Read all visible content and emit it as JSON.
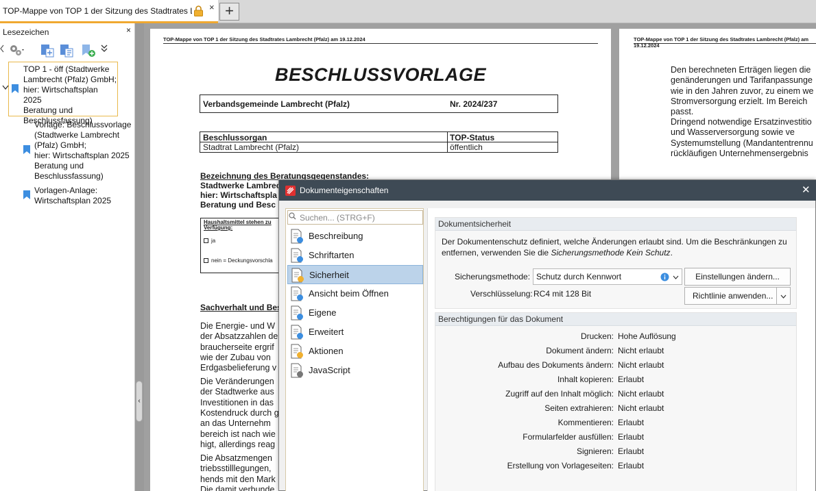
{
  "tab": {
    "title": "TOP-Mappe von TOP 1 der Sitzung des Stadtrates L...",
    "close": "×",
    "new_tab": "+"
  },
  "bookmarks": {
    "title": "Lesezeichen",
    "close": "×",
    "items": [
      {
        "label": "TOP 1 - öff (Stadtwerke\nLambrecht (Pfalz) GmbH;\nhier: Wirtschaftsplan 2025\nBeratung und\nBeschlussfassung)"
      },
      {
        "label": "Vorlage: Beschlussvorlage\n(Stadtwerke Lambrecht\n(Pfalz) GmbH;\nhier: Wirtschaftsplan 2025\nBeratung und\nBeschlussfassung)"
      },
      {
        "label": "Vorlagen-Anlage:\nWirtschaftsplan 2025"
      }
    ]
  },
  "page1": {
    "header": "TOP-Mappe von TOP 1 der Sitzung des Stadtrates Lambrecht (Pfalz) am 19.12.2024",
    "title": "BESCHLUSSVORLAGE",
    "org": "Verbandsgemeinde Lambrecht (Pfalz)",
    "nr": "Nr. 2024/237",
    "col1_head": "Beschlussorgan",
    "col2_head": "TOP-Status",
    "col1_val": "Stadtrat Lambrecht (Pfalz)",
    "col2_val": "öffentlich",
    "bez_lines": [
      "Bezeichnung des Beratungsgegenstandes:",
      "Stadtwerke Lambrec",
      "hier: Wirtschaftspla",
      "Beratung und Besc"
    ],
    "haushalt_1": "Haushaltsmittel stehen zu",
    "haushalt_2": "Verfügung:",
    "ja": "ja",
    "nein": "nein = Deckungsvorschla",
    "sachverhalt": "Sachverhalt und Bes",
    "para1": [
      "Die Energie- und W",
      "der Absatzzahlen de",
      "braucherseite ergrif",
      "wie der Zubau von",
      "Erdgasbelieferung v"
    ],
    "para2": [
      "Die Veränderungen",
      "der Stadtwerke aus",
      "Investitionen in das",
      "Kostendruck durch g",
      "an das Unternehm",
      "bereich ist nach wie",
      "higt, allerdings reag"
    ],
    "para3": [
      "Die Absatzmengen",
      "triebsstilllegungen,",
      "hends mit den Mark",
      "Die damit verbunde"
    ]
  },
  "page2": {
    "header": "TOP-Mappe von TOP 1 der Sitzung des Stadtrates Lambrecht (Pfalz) am 19.12.2024",
    "para1": [
      "Den berechneten Erträgen liegen die",
      "genänderungen und Tarifanpassunge",
      "wie in den Jahren zuvor, zu einem we",
      "Stromversorgung erzielt. Im Bereich",
      "passt."
    ],
    "para2": [
      "Dringend notwendige Ersatzinvestitio",
      "und    Wasserversorgung    sowie   ve",
      "Systemumstellung (Mandantentrennu",
      "rückläufigen Unternehmensergebnis"
    ]
  },
  "dialog": {
    "title": "Dokumenteigenschaften",
    "close": "✕",
    "search_placeholder": "Suchen... (STRG+F)",
    "nav": [
      {
        "label": "Beschreibung",
        "icon": "description-icon"
      },
      {
        "label": "Schriftarten",
        "icon": "fonts-icon"
      },
      {
        "label": "Sicherheit",
        "icon": "security-icon"
      },
      {
        "label": "Ansicht beim Öffnen",
        "icon": "view-on-open-icon"
      },
      {
        "label": "Eigene",
        "icon": "custom-properties-icon"
      },
      {
        "label": "Erweitert",
        "icon": "advanced-icon"
      },
      {
        "label": "Aktionen",
        "icon": "actions-icon"
      },
      {
        "label": "JavaScript",
        "icon": "javascript-icon"
      }
    ],
    "security": {
      "heading": "Dokumentsicherheit",
      "desc1": "Der Dokumentenschutz definiert, welche Änderungen erlaubt sind. Um die Beschränkungen zu",
      "desc2a": "entfernen, verwenden Sie die ",
      "desc2b": "Sicherungsmethode Kein Schutz",
      "desc2c": ".",
      "method_label": "Sicherungsmethode:",
      "method_value": "Schutz durch Kennwort",
      "btn_settings": "Einstellungen ändern...",
      "enc_label": "Verschlüsselung:",
      "enc_value": "RC4 mit 128 Bit",
      "btn_policy": "Richtlinie anwenden..."
    },
    "permissions": {
      "heading": "Berechtigungen für das Dokument",
      "rows": [
        {
          "label": "Drucken:",
          "value": "Hohe Auflösung"
        },
        {
          "label": "Dokument ändern:",
          "value": "Nicht erlaubt"
        },
        {
          "label": "Aufbau des Dokuments ändern:",
          "value": "Nicht erlaubt"
        },
        {
          "label": "Inhalt kopieren:",
          "value": "Erlaubt"
        },
        {
          "label": "Zugriff auf den Inhalt möglich:",
          "value": "Nicht erlaubt"
        },
        {
          "label": "Seiten extrahieren:",
          "value": "Nicht erlaubt"
        },
        {
          "label": "Kommentieren:",
          "value": "Erlaubt"
        },
        {
          "label": "Formularfelder ausfüllen:",
          "value": "Erlaubt"
        },
        {
          "label": "Signieren:",
          "value": "Erlaubt"
        },
        {
          "label": "Erstellung von Vorlageseiten:",
          "value": "Erlaubt"
        }
      ]
    }
  }
}
